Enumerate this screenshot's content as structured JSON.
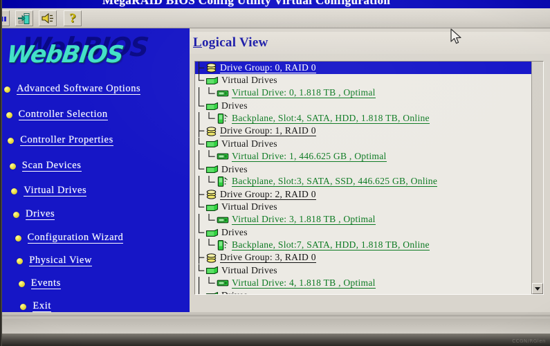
{
  "window": {
    "title": "MegaRAID BIOS Config Utility Virtual Configuration"
  },
  "toolbar": {
    "buttons": [
      {
        "name": "exit-icon",
        "label": "Exit"
      },
      {
        "name": "speaker-icon",
        "label": "Silence Alarm"
      },
      {
        "name": "help-icon",
        "label": "Help",
        "glyph": "?"
      }
    ]
  },
  "sidebar": {
    "logo": "WebBIOS",
    "items": [
      {
        "label": "Advanced Software Options"
      },
      {
        "label": "Controller Selection"
      },
      {
        "label": "Controller Properties"
      },
      {
        "label": "Scan Devices"
      },
      {
        "label": "Virtual Drives"
      },
      {
        "label": "Drives"
      },
      {
        "label": "Configuration Wizard"
      },
      {
        "label": "Physical View"
      },
      {
        "label": "Events"
      },
      {
        "label": "Exit"
      }
    ]
  },
  "content": {
    "view_title_accel": "L",
    "view_title_rest": "ogical View",
    "tree": [
      {
        "indent": 0,
        "icon": "drive-group-icon",
        "label": "Drive Group: 0, RAID 0",
        "style": "selected"
      },
      {
        "indent": 1,
        "icon": "folder-icon",
        "label": "Virtual Drives",
        "style": "plain"
      },
      {
        "indent": 2,
        "icon": "virtual-drive-icon",
        "label": "Virtual Drive: 0, 1.818 TB , Optimal",
        "style": "link"
      },
      {
        "indent": 1,
        "icon": "folder-icon",
        "label": "Drives",
        "style": "plain"
      },
      {
        "indent": 2,
        "icon": "physical-drive-icon",
        "label": "Backplane, Slot:4, SATA, HDD, 1.818 TB, Online",
        "style": "link"
      },
      {
        "indent": 0,
        "icon": "drive-group-icon",
        "label": "Drive Group: 1, RAID 0",
        "style": "plain-link"
      },
      {
        "indent": 1,
        "icon": "folder-icon",
        "label": "Virtual Drives",
        "style": "plain"
      },
      {
        "indent": 2,
        "icon": "virtual-drive-icon",
        "label": "Virtual Drive: 1, 446.625 GB , Optimal",
        "style": "link"
      },
      {
        "indent": 1,
        "icon": "folder-icon",
        "label": "Drives",
        "style": "plain"
      },
      {
        "indent": 2,
        "icon": "physical-drive-icon",
        "label": "Backplane, Slot:3, SATA, SSD, 446.625 GB, Online",
        "style": "link"
      },
      {
        "indent": 0,
        "icon": "drive-group-icon",
        "label": "Drive Group: 2, RAID 0",
        "style": "plain-link"
      },
      {
        "indent": 1,
        "icon": "folder-icon",
        "label": "Virtual Drives",
        "style": "plain"
      },
      {
        "indent": 2,
        "icon": "virtual-drive-icon",
        "label": "Virtual Drive: 3, 1.818 TB , Optimal",
        "style": "link"
      },
      {
        "indent": 1,
        "icon": "folder-icon",
        "label": "Drives",
        "style": "plain"
      },
      {
        "indent": 2,
        "icon": "physical-drive-icon",
        "label": "Backplane, Slot:7, SATA, HDD, 1.818 TB, Online",
        "style": "link"
      },
      {
        "indent": 0,
        "icon": "drive-group-icon",
        "label": "Drive Group: 3, RAID 0",
        "style": "plain-link"
      },
      {
        "indent": 1,
        "icon": "folder-icon",
        "label": "Virtual Drives",
        "style": "plain"
      },
      {
        "indent": 2,
        "icon": "virtual-drive-icon",
        "label": "Virtual Drive: 4, 1.818 TB , Optimal",
        "style": "link"
      },
      {
        "indent": 1,
        "icon": "folder-icon",
        "label": "Drives",
        "style": "plain"
      }
    ]
  },
  "colors": {
    "sidebar_bg": "#1616c6",
    "selection_bg": "#1414c8",
    "link_green": "#0c7a22",
    "logo_teal": "#44e0c8",
    "bullet_yellow": "#ede04a",
    "title_blue": "#1a1aa8"
  },
  "watermark": "CCGN/RGlen"
}
